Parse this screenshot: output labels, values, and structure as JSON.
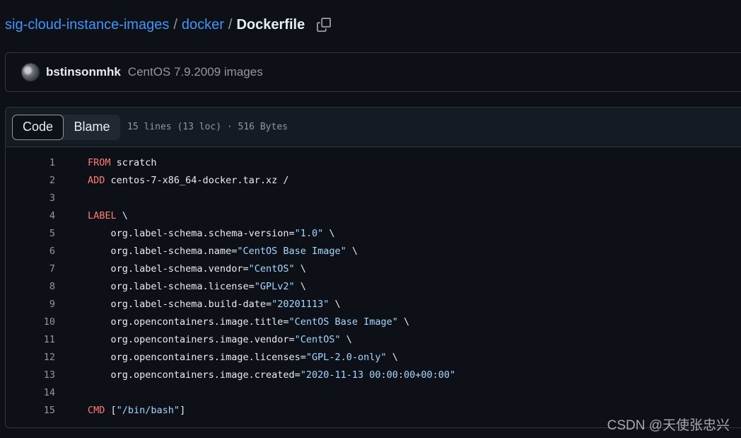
{
  "breadcrumb": {
    "repo": "sig-cloud-instance-images",
    "sep1": "/",
    "folder": "docker",
    "sep2": "/",
    "file": "Dockerfile"
  },
  "commit": {
    "author": "bstinsonmhk",
    "message": "CentOS 7.9.2009 images"
  },
  "file_header": {
    "tab_code": "Code",
    "tab_blame": "Blame",
    "meta": "15 lines (13 loc) · 516 Bytes"
  },
  "code_lines": [
    {
      "num": "1",
      "kw": "FROM",
      "text": " scratch",
      "str": "",
      "tail": ""
    },
    {
      "num": "2",
      "kw": "ADD",
      "text": " centos-7-x86_64-docker.tar.xz /",
      "str": "",
      "tail": ""
    },
    {
      "num": "3",
      "kw": "",
      "text": "",
      "str": "",
      "tail": ""
    },
    {
      "num": "4",
      "kw": "LABEL",
      "text": " \\",
      "str": "",
      "tail": ""
    },
    {
      "num": "5",
      "kw": "",
      "text": "    org.label-schema.schema-version=",
      "str": "\"1.0\"",
      "tail": " \\"
    },
    {
      "num": "6",
      "kw": "",
      "text": "    org.label-schema.name=",
      "str": "\"CentOS Base Image\"",
      "tail": " \\"
    },
    {
      "num": "7",
      "kw": "",
      "text": "    org.label-schema.vendor=",
      "str": "\"CentOS\"",
      "tail": " \\"
    },
    {
      "num": "8",
      "kw": "",
      "text": "    org.label-schema.license=",
      "str": "\"GPLv2\"",
      "tail": " \\"
    },
    {
      "num": "9",
      "kw": "",
      "text": "    org.label-schema.build-date=",
      "str": "\"20201113\"",
      "tail": " \\"
    },
    {
      "num": "10",
      "kw": "",
      "text": "    org.opencontainers.image.title=",
      "str": "\"CentOS Base Image\"",
      "tail": " \\"
    },
    {
      "num": "11",
      "kw": "",
      "text": "    org.opencontainers.image.vendor=",
      "str": "\"CentOS\"",
      "tail": " \\"
    },
    {
      "num": "12",
      "kw": "",
      "text": "    org.opencontainers.image.licenses=",
      "str": "\"GPL-2.0-only\"",
      "tail": " \\"
    },
    {
      "num": "13",
      "kw": "",
      "text": "    org.opencontainers.image.created=",
      "str": "\"2020-11-13 00:00:00+00:00\"",
      "tail": ""
    },
    {
      "num": "14",
      "kw": "",
      "text": "",
      "str": "",
      "tail": ""
    },
    {
      "num": "15",
      "kw": "CMD",
      "text": " [",
      "str": "\"/bin/bash\"",
      "tail": "]"
    }
  ],
  "watermark": "CSDN @天使张忠兴"
}
